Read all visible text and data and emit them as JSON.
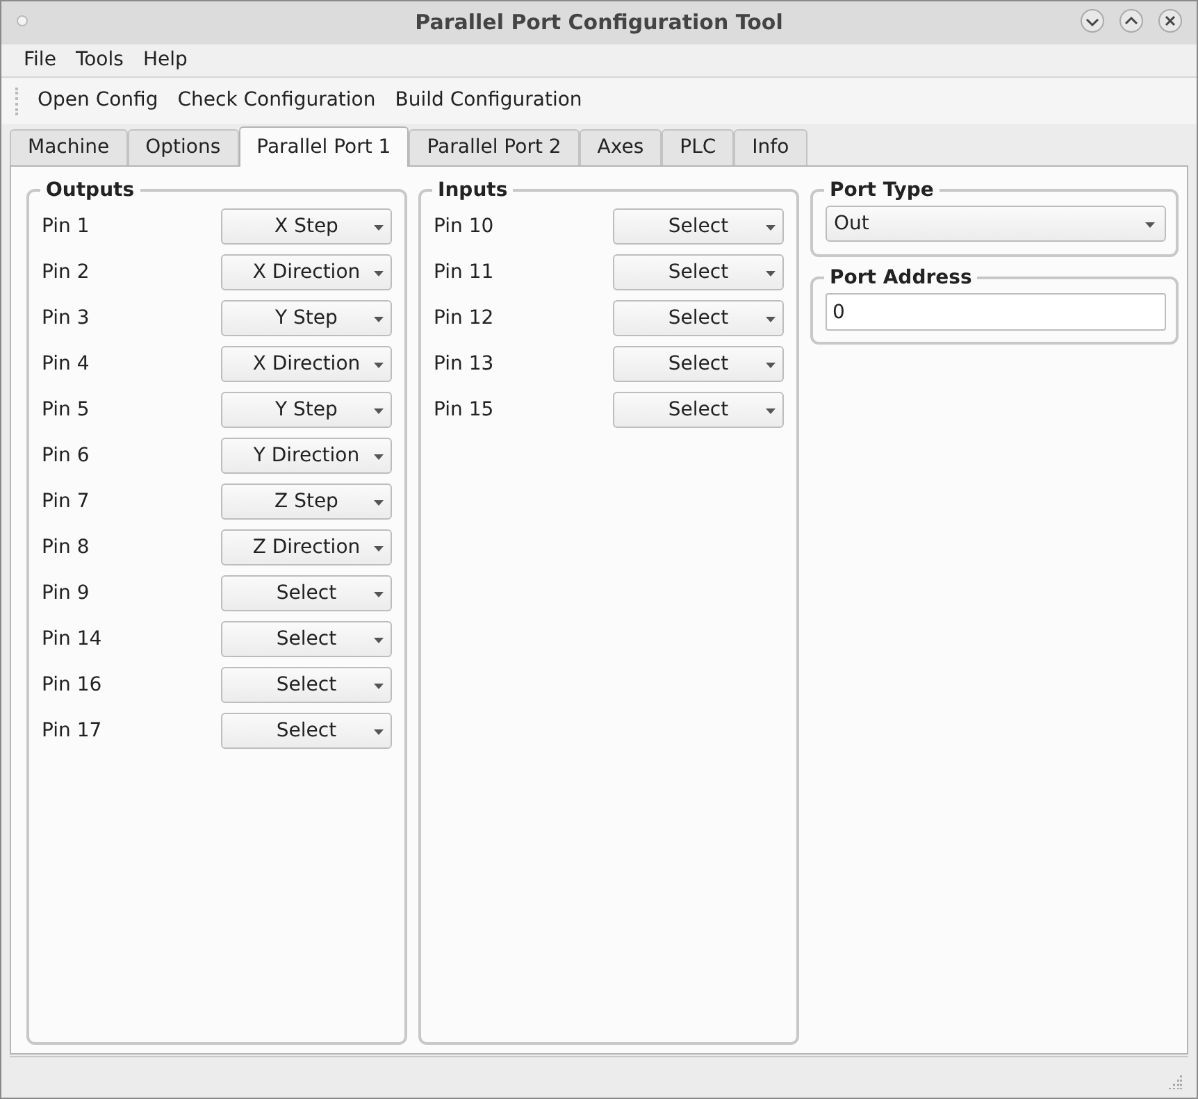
{
  "window": {
    "title": "Parallel Port Configuration Tool"
  },
  "menu": [
    "File",
    "Tools",
    "Help"
  ],
  "toolbar": [
    "Open Config",
    "Check Configuration",
    "Build Configuration"
  ],
  "tabs": [
    {
      "label": "Machine",
      "selected": false
    },
    {
      "label": "Options",
      "selected": false
    },
    {
      "label": "Parallel Port 1",
      "selected": true
    },
    {
      "label": "Parallel Port 2",
      "selected": false
    },
    {
      "label": "Axes",
      "selected": false
    },
    {
      "label": "PLC",
      "selected": false
    },
    {
      "label": "Info",
      "selected": false
    }
  ],
  "outputs": {
    "title": "Outputs",
    "pins": [
      {
        "label": "Pin 1",
        "value": "X Step"
      },
      {
        "label": "Pin 2",
        "value": "X Direction"
      },
      {
        "label": "Pin 3",
        "value": "Y Step"
      },
      {
        "label": "Pin 4",
        "value": "X Direction"
      },
      {
        "label": "Pin 5",
        "value": "Y Step"
      },
      {
        "label": "Pin 6",
        "value": "Y Direction"
      },
      {
        "label": "Pin 7",
        "value": "Z Step"
      },
      {
        "label": "Pin 8",
        "value": "Z Direction"
      },
      {
        "label": "Pin 9",
        "value": "Select"
      },
      {
        "label": "Pin 14",
        "value": "Select"
      },
      {
        "label": "Pin 16",
        "value": "Select"
      },
      {
        "label": "Pin 17",
        "value": "Select"
      }
    ]
  },
  "inputs": {
    "title": "Inputs",
    "pins": [
      {
        "label": "Pin 10",
        "value": "Select"
      },
      {
        "label": "Pin 11",
        "value": "Select"
      },
      {
        "label": "Pin 12",
        "value": "Select"
      },
      {
        "label": "Pin 13",
        "value": "Select"
      },
      {
        "label": "Pin 15",
        "value": "Select"
      }
    ]
  },
  "port_type": {
    "title": "Port Type",
    "value": "Out"
  },
  "port_address": {
    "title": "Port Address",
    "value": "0"
  }
}
